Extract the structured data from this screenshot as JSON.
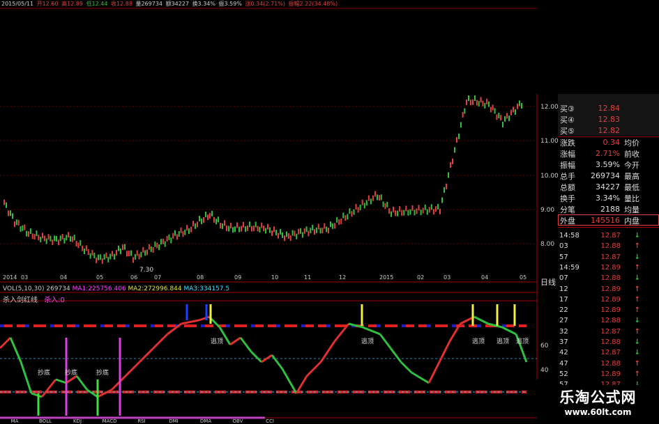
{
  "header": {
    "date": "2015/05/11",
    "open": "开12.60",
    "high": "高12.89",
    "low": "低12.44",
    "close": "收12.88",
    "volume": "量269734",
    "amount": "额34227",
    "turnover": "换3.34%",
    "amplitude": "振3.59%",
    "change": "涨0.34(2.71%)",
    "range": "振幅2.22(34.48%)"
  },
  "price_axis": [
    "12.00",
    "11.00",
    "10.00",
    "9.00",
    "8.00"
  ],
  "date_axis": [
    "2014",
    "03",
    "04",
    "05",
    "06",
    "07",
    "08",
    "09",
    "10",
    "11",
    "12",
    "2015",
    "02",
    "03",
    "04",
    "05"
  ],
  "period_label": "日线",
  "low_marker": "7.30",
  "vol_header": {
    "label": "VOL(5,10,30)",
    "vol": "269734",
    "ma1": "MA1:225756.406",
    "ma2": "MA2:272996.844",
    "ma3": "MA3:334157.5"
  },
  "indicator": {
    "name": "杀入剑红线",
    "value": "杀入:0",
    "tags_bottom": [
      "抄底",
      "抄底",
      "抄底"
    ],
    "tags_top": [
      "逃顶",
      "逃顶",
      "逃顶",
      "逃顶",
      "逃顶"
    ],
    "axis": [
      "60",
      "40"
    ]
  },
  "bottom_tabs": [
    "MA",
    "BOLL",
    "KDJ",
    "MACD",
    "RSI",
    "DMI",
    "DMA",
    "OBV",
    "CCI"
  ],
  "quote_panel": {
    "buy": [
      {
        "label": "买③",
        "value": "12.84"
      },
      {
        "label": "买④",
        "value": "12.83"
      },
      {
        "label": "买⑤",
        "value": "12.82"
      }
    ],
    "stats": [
      {
        "l1": "涨跌",
        "v": "0.34",
        "l2": "均价",
        "color": "#e04040"
      },
      {
        "l1": "涨幅",
        "v": "2.71%",
        "l2": "前收",
        "color": "#e04040"
      },
      {
        "l1": "振幅",
        "v": "3.59%",
        "l2": "今开",
        "color": "#dddddd"
      },
      {
        "l1": "总手",
        "v": "269734",
        "l2": "最高",
        "color": "#dddddd"
      },
      {
        "l1": "总额",
        "v": "34227",
        "l2": "最低",
        "color": "#dddddd"
      },
      {
        "l1": "换手",
        "v": "3.34%",
        "l2": "量比",
        "color": "#dddddd"
      },
      {
        "l1": "分笔",
        "v": "2188",
        "l2": "均量",
        "color": "#dddddd"
      },
      {
        "l1": "外盘",
        "v": "145516",
        "l2": "内盘",
        "color": "#e04040"
      }
    ],
    "ticks": [
      {
        "t": "14:58",
        "p": "12.87",
        "a": "↓",
        "c": "#30c040"
      },
      {
        "t": "03",
        "p": "12.88",
        "a": "↑",
        "c": "#e04040"
      },
      {
        "t": "57",
        "p": "12.87",
        "a": "↓",
        "c": "#30c040"
      },
      {
        "t": "14:59",
        "p": "12.89",
        "a": "↑",
        "c": "#e04040"
      },
      {
        "t": "07",
        "p": "12.88",
        "a": "↓",
        "c": "#30c040"
      },
      {
        "t": "12",
        "p": "12.89",
        "a": "↑",
        "c": "#e04040"
      },
      {
        "t": "17",
        "p": "12.89",
        "a": "↑",
        "c": "#e04040"
      },
      {
        "t": "22",
        "p": "12.89",
        "a": "↑",
        "c": "#e04040"
      },
      {
        "t": "27",
        "p": "12.88",
        "a": "↓",
        "c": "#30c040"
      },
      {
        "t": "32",
        "p": "12.87",
        "a": "↑",
        "c": "#e04040"
      },
      {
        "t": "37",
        "p": "12.88",
        "a": "↓",
        "c": "#30c040"
      },
      {
        "t": "42",
        "p": "12.87",
        "a": "↓",
        "c": "#30c040"
      },
      {
        "t": "47",
        "p": "12.88",
        "a": "↑",
        "c": "#e04040"
      },
      {
        "t": "52",
        "p": "12.89",
        "a": "↑",
        "c": "#e04040"
      },
      {
        "t": "57",
        "p": "12.87",
        "a": "↓",
        "c": "#30c040"
      }
    ]
  },
  "watermark": {
    "cn": "乐淘公式网",
    "url": "www.60lt.com"
  }
}
